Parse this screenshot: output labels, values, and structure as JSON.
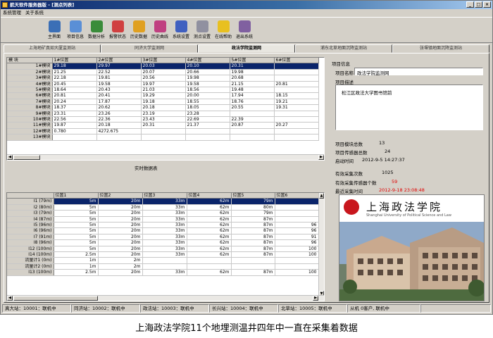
{
  "window": {
    "title": "航天软件服务器版 - [测点列表]"
  },
  "menu": [
    "系统管理",
    "关于系统"
  ],
  "toolbar": [
    {
      "label": "主界面",
      "icon": "home-icon",
      "color": "#3b6fb6"
    },
    {
      "label": "项目信息",
      "icon": "project-info-icon",
      "color": "#5a8fd6"
    },
    {
      "label": "数据分析",
      "icon": "data-analysis-icon",
      "color": "#3a8c3a"
    },
    {
      "label": "报警状态",
      "icon": "alarm-icon",
      "color": "#d04040"
    },
    {
      "label": "历史数据",
      "icon": "history-data-icon",
      "color": "#e0a020"
    },
    {
      "label": "历史曲线",
      "icon": "history-curve-icon",
      "color": "#c04080"
    },
    {
      "label": "系统设置",
      "icon": "settings-icon",
      "color": "#4060c0"
    },
    {
      "label": "测点设置",
      "icon": "point-settings-icon",
      "color": "#9090a0"
    },
    {
      "label": "在线帮助",
      "icon": "help-icon",
      "color": "#e8c020"
    },
    {
      "label": "退出系统",
      "icon": "exit-icon",
      "color": "#8060a0"
    }
  ],
  "tabs": [
    "上海地矿真如大厦监测站",
    "同济大学监测网",
    "政法学院监测网",
    "浦东北草地面沉降监测站",
    "张堰镇地面沉降监测站"
  ],
  "active_tab": 2,
  "top_table": {
    "corner": "模 块",
    "columns": [
      "1#位置",
      "2#位置",
      "3#位置",
      "4#位置",
      "5#位置",
      "6#位置"
    ],
    "rows": [
      {
        "label": "1#模块",
        "cells": [
          "29.18",
          "29.97",
          "20.03",
          "20.10",
          "20.31",
          ""
        ]
      },
      {
        "label": "2#模块",
        "cells": [
          "21.25",
          "22.52",
          "20.07",
          "20.66",
          "19.98",
          ""
        ]
      },
      {
        "label": "3#模块",
        "cells": [
          "22.18",
          "19.81",
          "20.56",
          "19.98",
          "20.68",
          ""
        ]
      },
      {
        "label": "4#模块",
        "cells": [
          "20.45",
          "19.58",
          "19.97",
          "19.58",
          "21.15",
          "20.81"
        ]
      },
      {
        "label": "5#模块",
        "cells": [
          "18.64",
          "20.43",
          "21.03",
          "18.56",
          "19.48",
          ""
        ]
      },
      {
        "label": "6#模块",
        "cells": [
          "20.81",
          "20.41",
          "19.29",
          "20.00",
          "17.94",
          "18.15"
        ]
      },
      {
        "label": "7#模块",
        "cells": [
          "20.24",
          "17.87",
          "19.18",
          "18.55",
          "18.76",
          "19.21"
        ]
      },
      {
        "label": "8#模块",
        "cells": [
          "18.37",
          "20.62",
          "20.18",
          "18.05",
          "20.55",
          "19.31"
        ]
      },
      {
        "label": "9#模块",
        "cells": [
          "23.31",
          "23.26",
          "23.19",
          "23.28",
          "",
          ""
        ]
      },
      {
        "label": "10#模块",
        "cells": [
          "22.56",
          "22.36",
          "23.43",
          "22.69",
          "22.39",
          ""
        ]
      },
      {
        "label": "11#模块",
        "cells": [
          "19.87",
          "20.18",
          "20.31",
          "21.37",
          "20.87",
          "20.27"
        ]
      },
      {
        "label": "12#模块",
        "cells": [
          "0.780",
          "4272.675",
          "",
          "",
          "",
          ""
        ]
      },
      {
        "label": "13#模块",
        "cells": [
          "",
          "",
          "",
          "",
          "",
          ""
        ]
      }
    ]
  },
  "realtime_label": "实时数据表",
  "bottom_table": {
    "corner": "",
    "columns": [
      "位置1",
      "位置2",
      "位置3",
      "位置4",
      "位置5",
      "位置6"
    ],
    "rows": [
      {
        "label": "I1 (79m)",
        "cells": [
          "5m",
          "20m",
          "33m",
          "62m",
          "79m",
          ""
        ]
      },
      {
        "label": "I2 (80m)",
        "cells": [
          "5m",
          "20m",
          "33m",
          "62m",
          "80m",
          ""
        ]
      },
      {
        "label": "I3 (79m)",
        "cells": [
          "5m",
          "20m",
          "33m",
          "62m",
          "79m",
          ""
        ]
      },
      {
        "label": "I4 (87m)",
        "cells": [
          "5m",
          "20m",
          "33m",
          "62m",
          "87m",
          ""
        ]
      },
      {
        "label": "I5 (96m)",
        "cells": [
          "5m",
          "20m",
          "33m",
          "62m",
          "87m",
          "96"
        ]
      },
      {
        "label": "I6 (96m)",
        "cells": [
          "5m",
          "20m",
          "33m",
          "62m",
          "87m",
          "96"
        ]
      },
      {
        "label": "I7 (91m)",
        "cells": [
          "5m",
          "20m",
          "33m",
          "62m",
          "87m",
          "91"
        ]
      },
      {
        "label": "I8 (96m)",
        "cells": [
          "5m",
          "20m",
          "33m",
          "62m",
          "87m",
          "96"
        ]
      },
      {
        "label": "I12 (100m)",
        "cells": [
          "5m",
          "20m",
          "33m",
          "62m",
          "87m",
          "100"
        ]
      },
      {
        "label": "I14 (100m)",
        "cells": [
          "2.5m",
          "20m",
          "33m",
          "62m",
          "87m",
          "100"
        ]
      },
      {
        "label": "流量计1 (0m)",
        "cells": [
          "1m",
          "2m",
          "",
          "",
          "",
          ""
        ]
      },
      {
        "label": "流量计2 (0m)",
        "cells": [
          "1m",
          "2m",
          "",
          "",
          "",
          ""
        ]
      },
      {
        "label": "I13 (100m)",
        "cells": [
          "2.5m",
          "20m",
          "33m",
          "62m",
          "87m",
          "100"
        ]
      }
    ]
  },
  "info_panel": {
    "section_title": "项目信息",
    "name_label": "项目名称",
    "name_value": "政法学院监测网",
    "desc_label": "项目描述",
    "desc_value": "松江区政法大学图书馆前",
    "total_modules_label": "项目模块总数",
    "total_modules": "13",
    "total_sensors_label": "项目传感器总数",
    "total_sensors": "24",
    "start_time_label": "启动时间",
    "start_time": "2012-9-5 14:27:37",
    "valid_count_label": "有效采集次数",
    "valid_count": "1025",
    "valid_sensors_label": "有效采集传感器个数",
    "valid_sensors": "59",
    "last_time_label": "最近采集时间",
    "last_time": "2012-9-18 23:08:48"
  },
  "photo": {
    "title_cn": "上海政法学院",
    "title_en": "Shanghai University of Political Science and Law",
    "bg_color": "#6e8fb8"
  },
  "status_bar": [
    "真大站：10001：联机中",
    "同济站：10002：联机中",
    "政法站：10003：联机中",
    "长兴站：10004：联机中",
    "北草站：10005：联机中",
    "从机 0客户, 联机中"
  ],
  "caption": "上海政法学院11个地埋测温井四年中一直在采集着数据"
}
